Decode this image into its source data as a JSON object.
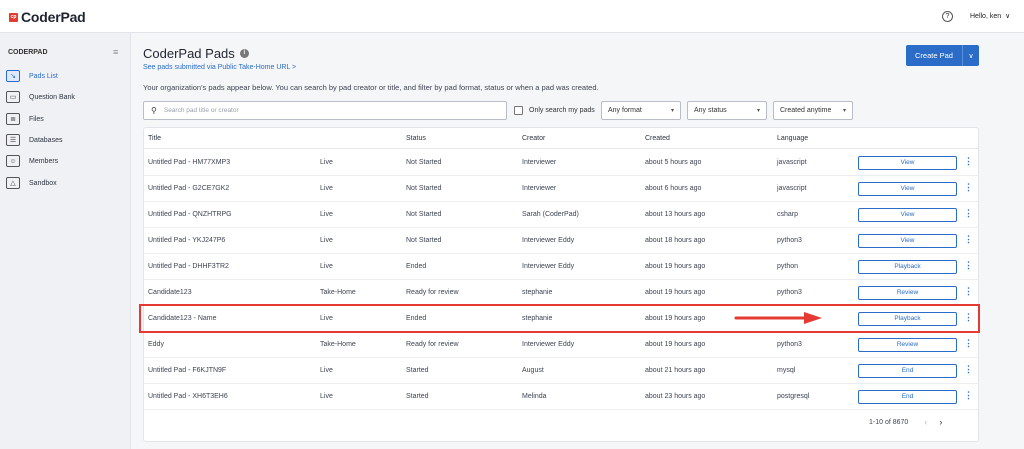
{
  "app": {
    "logo_mark": "cp",
    "logo_text": "CoderPad"
  },
  "topbar": {
    "help_icon": "?",
    "user_label": "Hello, ken",
    "user_chevron": "∨"
  },
  "sidebar": {
    "heading": "CODERPAD",
    "collapse_icon": "≡",
    "items": [
      {
        "label": "Pads List",
        "icon": "pads-icon",
        "glyph": "↘",
        "active": true
      },
      {
        "label": "Question Bank",
        "icon": "question-bank-icon",
        "glyph": "▭",
        "active": false
      },
      {
        "label": "Files",
        "icon": "files-icon",
        "glyph": "≣",
        "active": false
      },
      {
        "label": "Databases",
        "icon": "database-icon",
        "glyph": "☰",
        "active": false
      },
      {
        "label": "Members",
        "icon": "members-icon",
        "glyph": "☺",
        "active": false
      },
      {
        "label": "Sandbox",
        "icon": "sandbox-icon",
        "glyph": "△",
        "active": false
      }
    ]
  },
  "main": {
    "title": "CoderPad Pads",
    "info_icon": "i",
    "takehome_link": "See pads submitted via Public Take-Home URL >",
    "description": "Your organization's pads appear below. You can search by pad creator or title, and filter by pad format, status or when a pad was created.",
    "create_button": "Create Pad",
    "create_caret": "∨"
  },
  "filters": {
    "search_placeholder": "Search pad title or creator",
    "only_mine_label": "Only search my pads",
    "format": "Any format",
    "status": "Any status",
    "created": "Created anytime",
    "caret": "▾"
  },
  "table": {
    "headers": {
      "title": "Title",
      "status": "Status",
      "creator": "Creator",
      "created": "Created",
      "language": "Language"
    },
    "rows": [
      {
        "title": "Untitled Pad - HM77XMP3",
        "type": "Live",
        "status": "Not Started",
        "creator": "Interviewer",
        "created": "about 5 hours ago",
        "language": "javascript",
        "action": "View"
      },
      {
        "title": "Untitled Pad - G2CE7GK2",
        "type": "Live",
        "status": "Not Started",
        "creator": "Interviewer",
        "created": "about 6 hours ago",
        "language": "javascript",
        "action": "View"
      },
      {
        "title": "Untitled Pad - QNZHTRPG",
        "type": "Live",
        "status": "Not Started",
        "creator": "Sarah (CoderPad)",
        "created": "about 13 hours ago",
        "language": "csharp",
        "action": "View"
      },
      {
        "title": "Untitled Pad - YKJ247P6",
        "type": "Live",
        "status": "Not Started",
        "creator": "Interviewer Eddy",
        "created": "about 18 hours ago",
        "language": "python3",
        "action": "View"
      },
      {
        "title": "Untitled Pad - DHHF3TR2",
        "type": "Live",
        "status": "Ended",
        "creator": "Interviewer Eddy",
        "created": "about 19 hours ago",
        "language": "python",
        "action": "Playback"
      },
      {
        "title": "Candidate123",
        "type": "Take-Home",
        "status": "Ready for review",
        "creator": "stephanie",
        "created": "about 19 hours ago",
        "language": "python3",
        "action": "Review"
      },
      {
        "title": "Candidate123 - Name",
        "type": "Live",
        "status": "Ended",
        "creator": "stephanie",
        "created": "about 19 hours ago",
        "language": "",
        "action": "Playback"
      },
      {
        "title": "Eddy",
        "type": "Take-Home",
        "status": "Ready for review",
        "creator": "Interviewer Eddy",
        "created": "about 19 hours ago",
        "language": "python3",
        "action": "Review"
      },
      {
        "title": "Untitled Pad - F6KJTN9F",
        "type": "Live",
        "status": "Started",
        "creator": "August",
        "created": "about 21 hours ago",
        "language": "mysql",
        "action": "End"
      },
      {
        "title": "Untitled Pad - XH6T3EH6",
        "type": "Live",
        "status": "Started",
        "creator": "Melinda",
        "created": "about 23 hours ago",
        "language": "postgresql",
        "action": "End"
      }
    ],
    "kebab": "⋮",
    "pagination": {
      "range": "1-10 of 8670",
      "prev": "‹",
      "next": "›"
    }
  },
  "annotation": {
    "highlight_color": "#e53935"
  }
}
